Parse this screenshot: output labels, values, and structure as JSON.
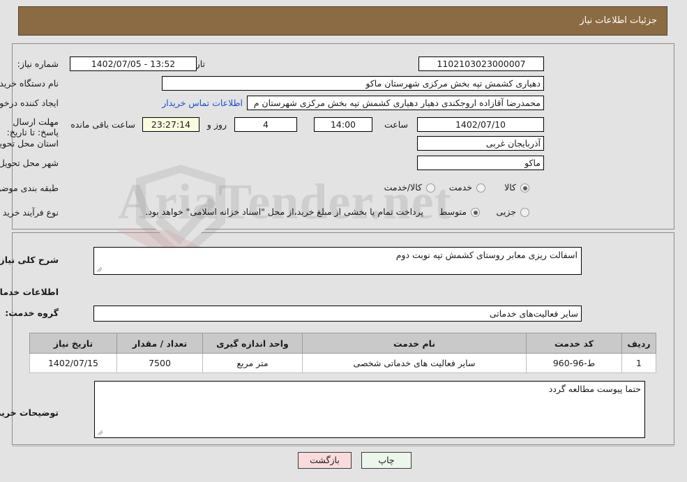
{
  "header": {
    "title": "جزئیات اطلاعات نیاز"
  },
  "top_panel": {
    "need_number_label": "شماره نیاز:",
    "need_number_value": "1102103023000007",
    "public_announce_label": "تاریخ و ساعت اعلان عمومی:",
    "public_announce_value": "13:52 - 1402/07/05",
    "buyer_org_label": "نام دستگاه خریدار:",
    "buyer_org_value": "دهیاری کشمش تپه بخش مرکزی شهرستان ماکو",
    "creator_label": "ایجاد کننده درخواست:",
    "creator_value": "محمدرضا آقازاده اروجکندی دهیار دهیاری کشمش تپه بخش مرکزی شهرستان م",
    "contact_link": "اطلاعات تماس خریدار",
    "deadline_label": "مهلت ارسال پاسخ: تا تاریخ:",
    "deadline_date": "1402/07/10",
    "hour_label": "ساعت",
    "deadline_time": "14:00",
    "days_value": "4",
    "days_label": "روز و",
    "countdown_value": "23:27:14",
    "remaining_label": "ساعت باقی مانده",
    "province_label": "استان محل تحویل:",
    "province_value": "آذربایجان غربی",
    "city_label": "شهر محل تحویل:",
    "city_value": "ماکو",
    "category_label": "طبقه بندی موضوعی:",
    "category_options": [
      {
        "label": "کالا",
        "selected": false
      },
      {
        "label": "خدمت",
        "selected": true
      },
      {
        "label": "کالا/خدمت",
        "selected": false
      }
    ],
    "purchase_type_label": "نوع فرآیند خرید :",
    "purchase_type_options": [
      {
        "label": "جزیی",
        "selected": false
      },
      {
        "label": "متوسط",
        "selected": true
      }
    ],
    "treasury_note": "پرداخت تمام یا بخشی از مبلغ خرید،از محل \"اسناد خزانه اسلامی\" خواهد بود."
  },
  "bottom_panel": {
    "general_desc_label": "شرح کلی نیاز:",
    "general_desc_value": "اسفالت ریزی معابر روستای کشمش تپه نوبت دوم",
    "services_section_title": "اطلاعات خدمات مورد نیاز",
    "service_group_label": "گروه خدمت:",
    "service_group_value": "سایر فعالیت‌های خدماتی",
    "table": {
      "headers": [
        "ردیف",
        "کد خدمت",
        "نام خدمت",
        "واحد اندازه گیری",
        "تعداد / مقدار",
        "تاریخ نیاز"
      ],
      "rows": [
        {
          "row": "1",
          "code": "ط-96-960",
          "name": "سایر فعالیت های خدماتی شخصی",
          "unit": "متر مربع",
          "quantity": "7500",
          "date": "1402/07/15"
        }
      ]
    },
    "buyer_notes_label": "توضیحات خریدار:",
    "buyer_notes_value": "حتما پیوست مطالعه گردد"
  },
  "footer": {
    "print_label": "چاپ",
    "back_label": "بازگشت"
  },
  "watermark": {
    "text": "AriaTender.net"
  },
  "colors": {
    "header_bg": "#8b6b43",
    "page_bg": "#e3e3e3",
    "link": "#1a4fcc",
    "countdown_bg": "#fbfbe0",
    "print_bg": "#eaf7ea",
    "back_bg": "#fadbdb"
  }
}
